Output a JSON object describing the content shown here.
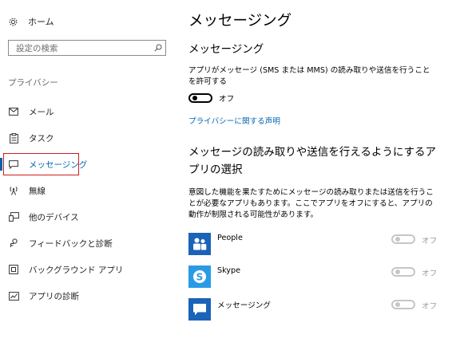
{
  "sidebar": {
    "home_label": "ホーム",
    "search_placeholder": "設定の検索",
    "section_label": "プライバシー",
    "items": [
      {
        "label": "メール",
        "icon": "mail-icon"
      },
      {
        "label": "タスク",
        "icon": "tasks-icon"
      },
      {
        "label": "メッセージング",
        "icon": "messaging-icon",
        "selected": true
      },
      {
        "label": "無線",
        "icon": "radio-icon"
      },
      {
        "label": "他のデバイス",
        "icon": "other-devices-icon"
      },
      {
        "label": "フィードバックと診断",
        "icon": "feedback-icon"
      },
      {
        "label": "バックグラウンド アプリ",
        "icon": "background-apps-icon"
      },
      {
        "label": "アプリの診断",
        "icon": "app-diagnostics-icon"
      }
    ]
  },
  "main": {
    "title": "メッセージング",
    "subtitle": "メッセージング",
    "description": "アプリがメッセージ (SMS または MMS) の読み取りや送信を行うことを許可する",
    "toggle_state": "オフ",
    "privacy_link": "プライバシーに関する声明",
    "apps_heading": "メッセージの読み取りや送信を行えるようにするアプリの選択",
    "apps_description": "意図した機能を果たすためにメッセージの読み取りまたは送信を行うことが必要なアプリもあります。ここでアプリをオフにすると、アプリの動作が制限される可能性があります。",
    "apps": [
      {
        "name": "People",
        "toggle_state": "オフ",
        "icon": "people-icon"
      },
      {
        "name": "Skype",
        "toggle_state": "オフ",
        "icon": "skype-icon"
      },
      {
        "name": "メッセージング",
        "toggle_state": "オフ",
        "icon": "messaging-app-icon"
      }
    ]
  },
  "colors": {
    "accent": "#0063b1",
    "selection_outline": "#d01c1c"
  }
}
